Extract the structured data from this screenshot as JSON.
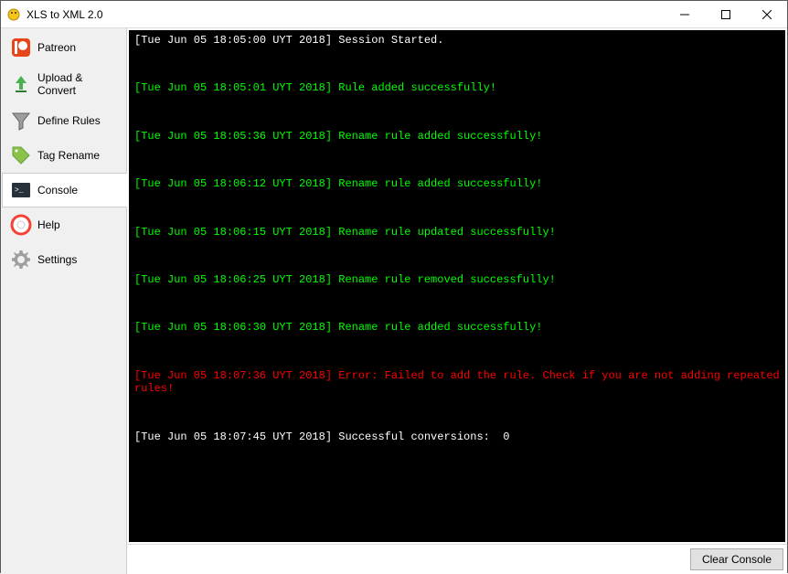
{
  "window": {
    "title": "XLS to XML 2.0"
  },
  "sidebar": {
    "items": [
      {
        "label": "Patreon",
        "icon": "patreon-icon"
      },
      {
        "label": "Upload & Convert",
        "icon": "upload-icon"
      },
      {
        "label": "Define Rules",
        "icon": "funnel-icon"
      },
      {
        "label": "Tag Rename",
        "icon": "tag-icon"
      },
      {
        "label": "Console",
        "icon": "console-icon"
      },
      {
        "label": "Help",
        "icon": "help-icon"
      },
      {
        "label": "Settings",
        "icon": "gear-icon"
      }
    ],
    "active_index": 4
  },
  "console": {
    "entries": [
      {
        "timestamp": "[Tue Jun 05 18:05:00 UYT 2018]",
        "message": "Session Started.",
        "level": "info"
      },
      {
        "timestamp": "[Tue Jun 05 18:05:01 UYT 2018]",
        "message": "Rule added successfully!",
        "level": "success"
      },
      {
        "timestamp": "[Tue Jun 05 18:05:36 UYT 2018]",
        "message": "Rename rule added successfully!",
        "level": "success"
      },
      {
        "timestamp": "[Tue Jun 05 18:06:12 UYT 2018]",
        "message": "Rename rule added successfully!",
        "level": "success"
      },
      {
        "timestamp": "[Tue Jun 05 18:06:15 UYT 2018]",
        "message": "Rename rule updated successfully!",
        "level": "success"
      },
      {
        "timestamp": "[Tue Jun 05 18:06:25 UYT 2018]",
        "message": "Rename rule removed successfully!",
        "level": "success"
      },
      {
        "timestamp": "[Tue Jun 05 18:06:30 UYT 2018]",
        "message": "Rename rule added successfully!",
        "level": "success"
      },
      {
        "timestamp": "[Tue Jun 05 18:07:36 UYT 2018]",
        "message": "Error: Failed to add the rule. Check if you are not adding repeated rules!",
        "level": "error"
      },
      {
        "timestamp": "[Tue Jun 05 18:07:45 UYT 2018]",
        "message": "Successful conversions:  0",
        "level": "info"
      }
    ]
  },
  "buttons": {
    "clear_console": "Clear Console"
  }
}
